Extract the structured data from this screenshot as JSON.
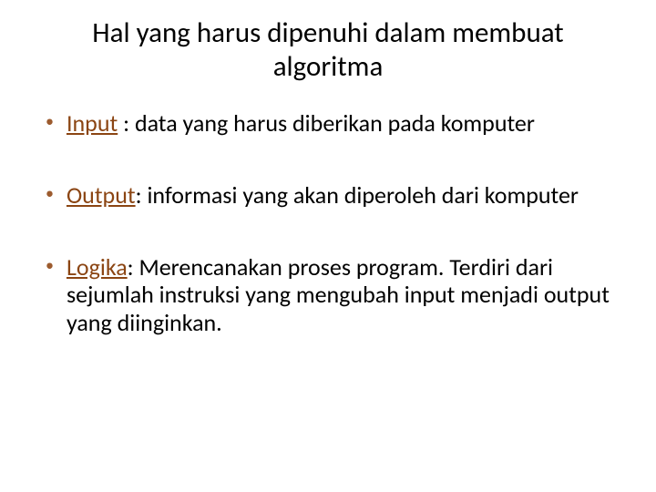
{
  "title": "Hal yang harus dipenuhi dalam membuat algoritma",
  "items": [
    {
      "term": "Input",
      "separator": " : ",
      "desc": "data yang harus diberikan pada komputer"
    },
    {
      "term": "Output",
      "separator": ": ",
      "desc": "informasi yang akan diperoleh dari komputer"
    },
    {
      "term": "Logika",
      "separator": ": ",
      "desc": "Merencanakan proses program. Terdiri dari sejumlah instruksi yang mengubah input menjadi output yang diinginkan."
    }
  ]
}
